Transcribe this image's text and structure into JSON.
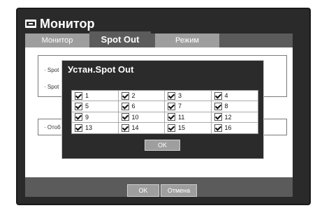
{
  "window": {
    "title": "Монитор",
    "icon": "monitor-icon"
  },
  "tabs": [
    {
      "label": "Монитор",
      "state": "inactive"
    },
    {
      "label": "Spot Out",
      "state": "active"
    },
    {
      "label": "Режим",
      "state": "inactive"
    }
  ],
  "background_fragments": [
    "· Spot",
    "· Spot",
    "· Отоб"
  ],
  "dialog": {
    "title": "Устан.Spot Out",
    "channels": [
      "1",
      "2",
      "3",
      "4",
      "5",
      "6",
      "7",
      "8",
      "9",
      "10",
      "11",
      "12",
      "13",
      "14",
      "15",
      "16"
    ],
    "ok_label": "OK"
  },
  "footer": {
    "ok_label": "OK",
    "cancel_label": "Отмена"
  }
}
